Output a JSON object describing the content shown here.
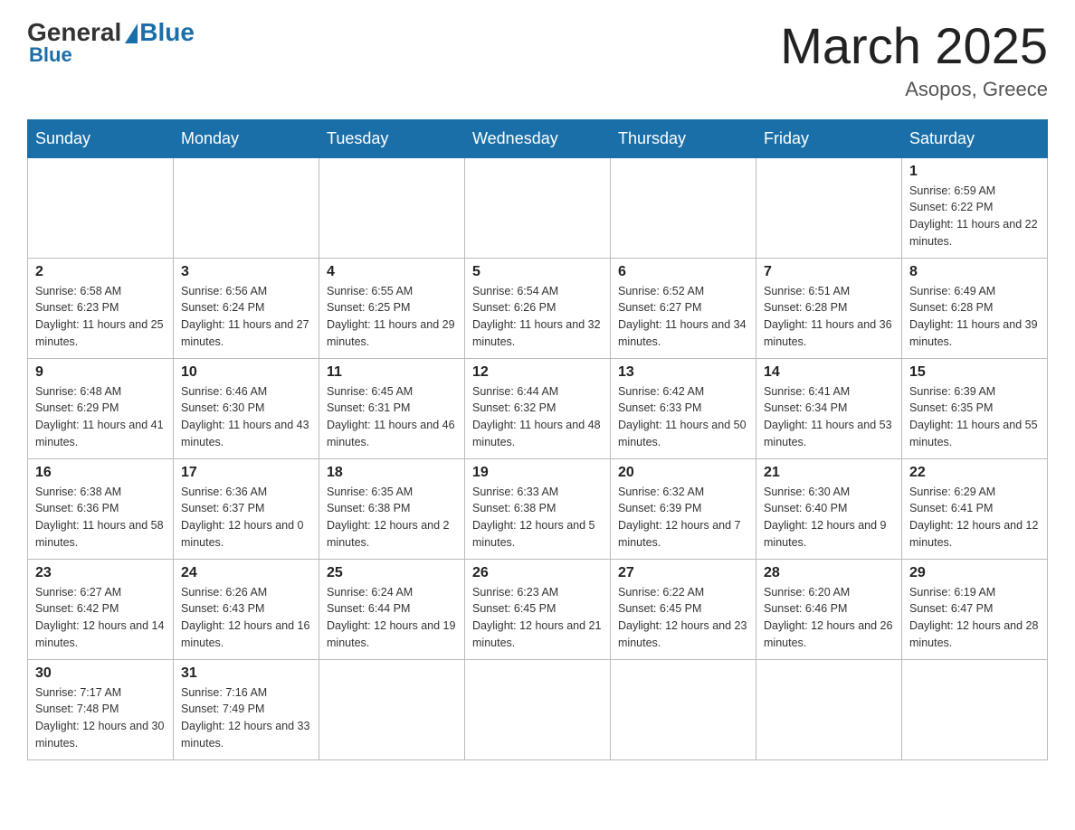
{
  "header": {
    "logo_general": "General",
    "logo_blue": "Blue",
    "month_title": "March 2025",
    "location": "Asopos, Greece"
  },
  "weekdays": [
    "Sunday",
    "Monday",
    "Tuesday",
    "Wednesday",
    "Thursday",
    "Friday",
    "Saturday"
  ],
  "weeks": [
    [
      {
        "day": "",
        "info": ""
      },
      {
        "day": "",
        "info": ""
      },
      {
        "day": "",
        "info": ""
      },
      {
        "day": "",
        "info": ""
      },
      {
        "day": "",
        "info": ""
      },
      {
        "day": "",
        "info": ""
      },
      {
        "day": "1",
        "info": "Sunrise: 6:59 AM\nSunset: 6:22 PM\nDaylight: 11 hours and 22 minutes."
      }
    ],
    [
      {
        "day": "2",
        "info": "Sunrise: 6:58 AM\nSunset: 6:23 PM\nDaylight: 11 hours and 25 minutes."
      },
      {
        "day": "3",
        "info": "Sunrise: 6:56 AM\nSunset: 6:24 PM\nDaylight: 11 hours and 27 minutes."
      },
      {
        "day": "4",
        "info": "Sunrise: 6:55 AM\nSunset: 6:25 PM\nDaylight: 11 hours and 29 minutes."
      },
      {
        "day": "5",
        "info": "Sunrise: 6:54 AM\nSunset: 6:26 PM\nDaylight: 11 hours and 32 minutes."
      },
      {
        "day": "6",
        "info": "Sunrise: 6:52 AM\nSunset: 6:27 PM\nDaylight: 11 hours and 34 minutes."
      },
      {
        "day": "7",
        "info": "Sunrise: 6:51 AM\nSunset: 6:28 PM\nDaylight: 11 hours and 36 minutes."
      },
      {
        "day": "8",
        "info": "Sunrise: 6:49 AM\nSunset: 6:28 PM\nDaylight: 11 hours and 39 minutes."
      }
    ],
    [
      {
        "day": "9",
        "info": "Sunrise: 6:48 AM\nSunset: 6:29 PM\nDaylight: 11 hours and 41 minutes."
      },
      {
        "day": "10",
        "info": "Sunrise: 6:46 AM\nSunset: 6:30 PM\nDaylight: 11 hours and 43 minutes."
      },
      {
        "day": "11",
        "info": "Sunrise: 6:45 AM\nSunset: 6:31 PM\nDaylight: 11 hours and 46 minutes."
      },
      {
        "day": "12",
        "info": "Sunrise: 6:44 AM\nSunset: 6:32 PM\nDaylight: 11 hours and 48 minutes."
      },
      {
        "day": "13",
        "info": "Sunrise: 6:42 AM\nSunset: 6:33 PM\nDaylight: 11 hours and 50 minutes."
      },
      {
        "day": "14",
        "info": "Sunrise: 6:41 AM\nSunset: 6:34 PM\nDaylight: 11 hours and 53 minutes."
      },
      {
        "day": "15",
        "info": "Sunrise: 6:39 AM\nSunset: 6:35 PM\nDaylight: 11 hours and 55 minutes."
      }
    ],
    [
      {
        "day": "16",
        "info": "Sunrise: 6:38 AM\nSunset: 6:36 PM\nDaylight: 11 hours and 58 minutes."
      },
      {
        "day": "17",
        "info": "Sunrise: 6:36 AM\nSunset: 6:37 PM\nDaylight: 12 hours and 0 minutes."
      },
      {
        "day": "18",
        "info": "Sunrise: 6:35 AM\nSunset: 6:38 PM\nDaylight: 12 hours and 2 minutes."
      },
      {
        "day": "19",
        "info": "Sunrise: 6:33 AM\nSunset: 6:38 PM\nDaylight: 12 hours and 5 minutes."
      },
      {
        "day": "20",
        "info": "Sunrise: 6:32 AM\nSunset: 6:39 PM\nDaylight: 12 hours and 7 minutes."
      },
      {
        "day": "21",
        "info": "Sunrise: 6:30 AM\nSunset: 6:40 PM\nDaylight: 12 hours and 9 minutes."
      },
      {
        "day": "22",
        "info": "Sunrise: 6:29 AM\nSunset: 6:41 PM\nDaylight: 12 hours and 12 minutes."
      }
    ],
    [
      {
        "day": "23",
        "info": "Sunrise: 6:27 AM\nSunset: 6:42 PM\nDaylight: 12 hours and 14 minutes."
      },
      {
        "day": "24",
        "info": "Sunrise: 6:26 AM\nSunset: 6:43 PM\nDaylight: 12 hours and 16 minutes."
      },
      {
        "day": "25",
        "info": "Sunrise: 6:24 AM\nSunset: 6:44 PM\nDaylight: 12 hours and 19 minutes."
      },
      {
        "day": "26",
        "info": "Sunrise: 6:23 AM\nSunset: 6:45 PM\nDaylight: 12 hours and 21 minutes."
      },
      {
        "day": "27",
        "info": "Sunrise: 6:22 AM\nSunset: 6:45 PM\nDaylight: 12 hours and 23 minutes."
      },
      {
        "day": "28",
        "info": "Sunrise: 6:20 AM\nSunset: 6:46 PM\nDaylight: 12 hours and 26 minutes."
      },
      {
        "day": "29",
        "info": "Sunrise: 6:19 AM\nSunset: 6:47 PM\nDaylight: 12 hours and 28 minutes."
      }
    ],
    [
      {
        "day": "30",
        "info": "Sunrise: 7:17 AM\nSunset: 7:48 PM\nDaylight: 12 hours and 30 minutes."
      },
      {
        "day": "31",
        "info": "Sunrise: 7:16 AM\nSunset: 7:49 PM\nDaylight: 12 hours and 33 minutes."
      },
      {
        "day": "",
        "info": ""
      },
      {
        "day": "",
        "info": ""
      },
      {
        "day": "",
        "info": ""
      },
      {
        "day": "",
        "info": ""
      },
      {
        "day": "",
        "info": ""
      }
    ]
  ]
}
